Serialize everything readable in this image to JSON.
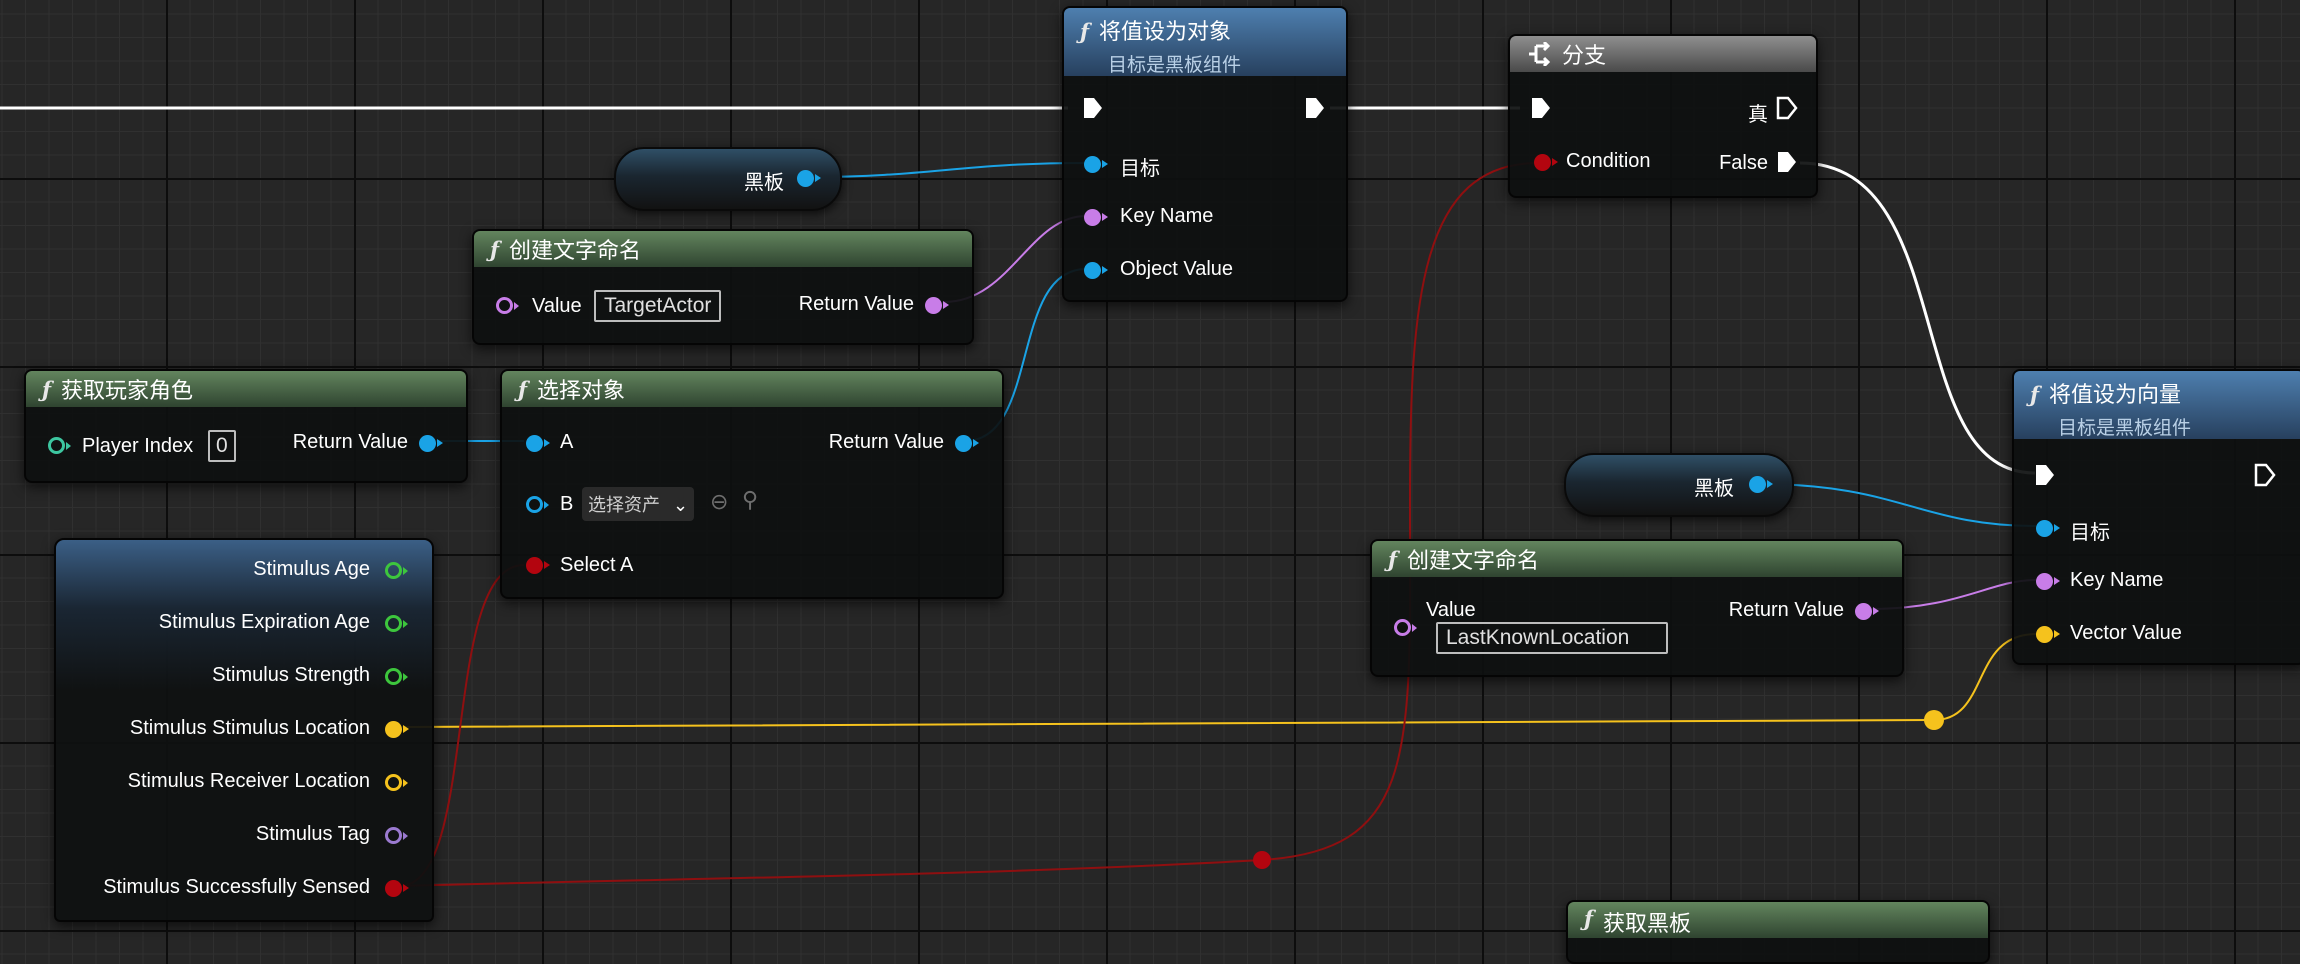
{
  "colors": {
    "object": "#1aa3e6",
    "name": "#c87de8",
    "bool": "#b3050f",
    "float": "#3dc63d",
    "vector": "#f5c21d",
    "tag": "#9b7ad0",
    "exec": "#ffffff"
  },
  "set_object_node": {
    "title": "将值设为对象",
    "subtitle": "目标是黑板组件",
    "target_label": "目标",
    "key_name_label": "Key Name",
    "object_value_label": "Object Value"
  },
  "branch_node": {
    "title": "分支",
    "true_label": "真",
    "condition_label": "Condition",
    "false_label": "False"
  },
  "blackboard_var_1": {
    "label": "黑板"
  },
  "make_literal_name_1": {
    "title": "创建文字命名",
    "value_label": "Value",
    "value": "TargetActor",
    "return_label": "Return Value"
  },
  "get_player_character": {
    "title": "获取玩家角色",
    "player_index_label": "Player Index",
    "player_index_value": "0",
    "return_label": "Return Value"
  },
  "select_object_node": {
    "title": "选择对象",
    "a_label": "A",
    "b_label": "B",
    "b_placeholder": "选择资产",
    "select_a_label": "Select A",
    "return_label": "Return Value"
  },
  "stimulus_break": {
    "pins": [
      "Stimulus Age",
      "Stimulus Expiration Age",
      "Stimulus Strength",
      "Stimulus Stimulus Location",
      "Stimulus Receiver Location",
      "Stimulus Tag",
      "Stimulus Successfully Sensed"
    ]
  },
  "set_vector_node": {
    "title": "将值设为向量",
    "subtitle": "目标是黑板组件",
    "target_label": "目标",
    "key_name_label": "Key Name",
    "vector_value_label": "Vector Value"
  },
  "blackboard_var_2": {
    "label": "黑板"
  },
  "make_literal_name_2": {
    "title": "创建文字命名",
    "value_label": "Value",
    "value": "LastKnownLocation",
    "return_label": "Return Value"
  },
  "partial_node": {
    "title": "获取黑板"
  }
}
